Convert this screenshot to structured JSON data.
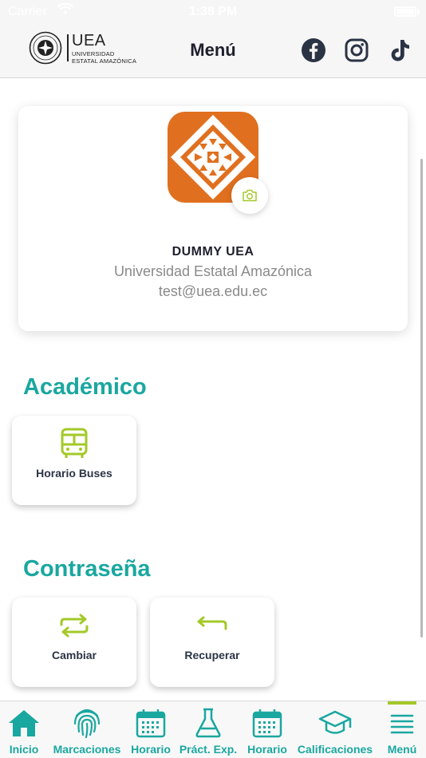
{
  "status_bar": {
    "carrier": "Carrier",
    "time": "1:38 PM"
  },
  "header": {
    "logo": {
      "brand": "UEA",
      "line1": "UNIVERSIDAD",
      "line2": "ESTATAL AMAZÓNICA"
    },
    "title": "Menú",
    "social": [
      "facebook-icon",
      "instagram-icon",
      "tiktok-icon"
    ]
  },
  "profile": {
    "name": "DUMMY UEA",
    "university": "Universidad Estatal Amazónica",
    "email": "test@uea.edu.ec"
  },
  "sections": [
    {
      "title": "Académico",
      "tiles": [
        {
          "label": "Horario Buses",
          "icon": "bus-icon"
        }
      ]
    },
    {
      "title": "Contraseña",
      "tiles": [
        {
          "label": "Cambiar",
          "icon": "swap-arrows-icon"
        },
        {
          "label": "Recuperar",
          "icon": "return-arrow-icon"
        }
      ]
    }
  ],
  "tabs": [
    {
      "label": "Inicio",
      "icon": "home-icon"
    },
    {
      "label": "Marcaciones",
      "icon": "fingerprint-icon"
    },
    {
      "label": "Horario",
      "icon": "calendar-icon"
    },
    {
      "label": "Práct. Exp.",
      "icon": "flask-icon"
    },
    {
      "label": "Horario",
      "icon": "calendar-icon"
    },
    {
      "label": "Calificaciones",
      "icon": "graduation-cap-icon"
    },
    {
      "label": "Menú",
      "icon": "menu-icon",
      "active": true
    }
  ],
  "colors": {
    "accent": "#1aa7a0",
    "highlight": "#a3c928",
    "avatar": "#e0701f"
  }
}
